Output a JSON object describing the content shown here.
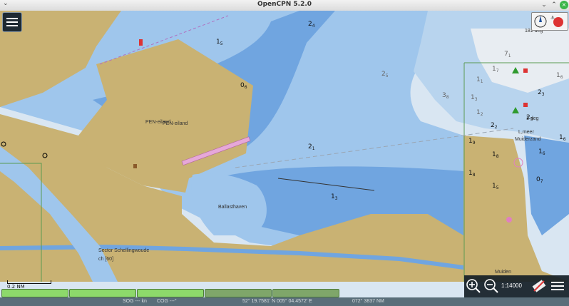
{
  "window": {
    "title": "OpenCPN 5.2.0",
    "menu_glyph": "⌄",
    "min_glyph": "⌄",
    "max_glyph": "⌃",
    "close_glyph": "×"
  },
  "chart": {
    "place_labels": {
      "pen_eiland_1": "PEN-eiland",
      "pen_eiland_2": "PEN-eiland",
      "ballasthaven": "Ballasthaven",
      "sector": "Sector Schellingwoude",
      "sector_ch": "ch [60]",
      "lmeer": "L,meer",
      "muiderzand": "Muiderzand",
      "muiden": "Muiden",
      "deg_top": "181 deg",
      "deg_mid": "1 deg"
    },
    "soundings": [
      {
        "main": "2",
        "sub": "4"
      },
      {
        "main": "1",
        "sub": "5"
      },
      {
        "main": "0",
        "sub": "6"
      },
      {
        "main": "2",
        "sub": "5"
      },
      {
        "main": "3",
        "sub": "8"
      },
      {
        "main": "2",
        "sub": "1"
      },
      {
        "main": "1",
        "sub": "3"
      },
      {
        "main": "1",
        "sub": "9"
      },
      {
        "main": "1",
        "sub": "8"
      },
      {
        "main": "1",
        "sub": "8"
      },
      {
        "main": "1",
        "sub": "5"
      },
      {
        "main": "1",
        "sub": "6"
      },
      {
        "main": "0",
        "sub": "7"
      },
      {
        "main": "2",
        "sub": "2"
      },
      {
        "main": "2",
        "sub": "3"
      },
      {
        "main": "2",
        "sub": "3"
      },
      {
        "main": "1",
        "sub": "3"
      },
      {
        "main": "1",
        "sub": "2"
      },
      {
        "main": "1",
        "sub": "7"
      },
      {
        "main": "1",
        "sub": "1"
      },
      {
        "main": "7",
        "sub": "1"
      },
      {
        "main": "1",
        "sub": "6"
      },
      {
        "main": "1",
        "sub": "6"
      }
    ],
    "scalebar_label": "0.2 NM"
  },
  "toolbar": {
    "scale": "1:14000"
  },
  "status": {
    "sog": "SOG --- kn",
    "cog": "COG ---°",
    "position": "52° 19.7581' N   005° 04.4572' E",
    "bearing": "072°  3837 NM"
  },
  "colors": {
    "land": "#c9b273",
    "deep": "#d9e6f2",
    "medium": "#9fc6ec",
    "shallow": "#70a5e0",
    "status": "#5a6e7a",
    "piano": "#8dd96b"
  }
}
